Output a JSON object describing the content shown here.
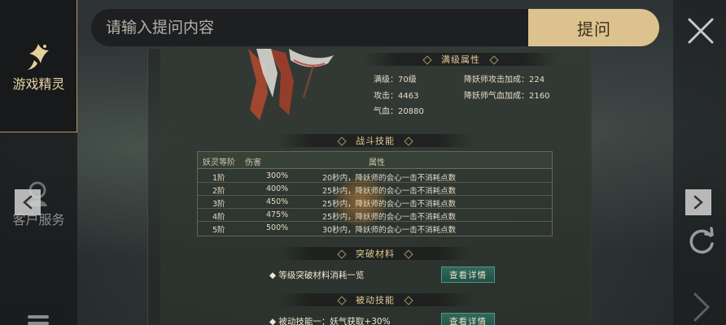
{
  "sidebar": {
    "sprite_label": "游戏精灵",
    "service_label": "客户服务"
  },
  "search": {
    "placeholder": "请输入提问内容",
    "ask_label": "提问"
  },
  "sections": {
    "max_attributes": {
      "title": "满级属性",
      "level": "满级：70级",
      "attack": "攻击：4463",
      "hp": "气血：20880",
      "attack_bonus": "降妖师攻击加成：224",
      "hp_bonus": "降妖师气血加成：2160"
    },
    "combat_skills": {
      "title": "战斗技能",
      "headers": [
        "妖灵等阶",
        "伤害",
        "属性"
      ],
      "rows": [
        {
          "tier": "1阶",
          "damage": "300%",
          "effect": "20秒内，降妖师的会心一击不消耗点数"
        },
        {
          "tier": "2阶",
          "damage": "400%",
          "effect": "25秒内，降妖师的会心一击不消耗点数"
        },
        {
          "tier": "3阶",
          "damage": "450%",
          "effect": "25秒内，降妖师的会心一击不消耗点数"
        },
        {
          "tier": "4阶",
          "damage": "475%",
          "effect": "25秒内，降妖师的会心一击不消耗点数"
        },
        {
          "tier": "5阶",
          "damage": "500%",
          "effect": "30秒内，降妖师的会心一击不消耗点数"
        }
      ]
    },
    "breakthrough": {
      "title": "突破材料",
      "line": "等级突破材料消耗一览",
      "button": "查看详情"
    },
    "passive": {
      "title": "被动技能",
      "line": "被动技能一：妖气获取+30%",
      "button": "查看详情"
    }
  },
  "colors": {
    "accent_gold": "#dcc28e",
    "header_text": "#e1c995",
    "detail_button": "#2f6a5e"
  }
}
